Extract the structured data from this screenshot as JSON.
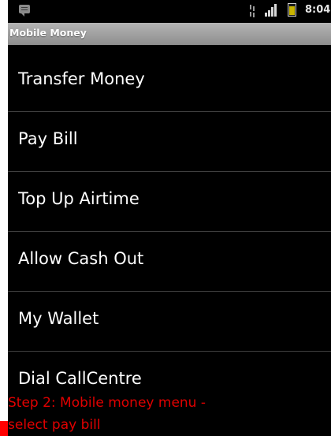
{
  "status_bar": {
    "time": "8:04",
    "icons": [
      "message-icon",
      "data-transfer-icon",
      "signal-icon",
      "battery-icon"
    ]
  },
  "app": {
    "title": "Mobile Money"
  },
  "menu": {
    "items": [
      {
        "label": "Transfer Money"
      },
      {
        "label": "Pay Bill"
      },
      {
        "label": "Top Up Airtime"
      },
      {
        "label": "Allow Cash Out"
      },
      {
        "label": "My Wallet"
      },
      {
        "label": "Dial CallCentre"
      }
    ]
  },
  "caption": {
    "line1": "Step 2: Mobile money menu -",
    "line2": "select pay bill"
  },
  "colors": {
    "background": "#000000",
    "title_bar": "#a6a6a6",
    "divider": "#3f3f3f",
    "caption_text": "#e00000"
  }
}
